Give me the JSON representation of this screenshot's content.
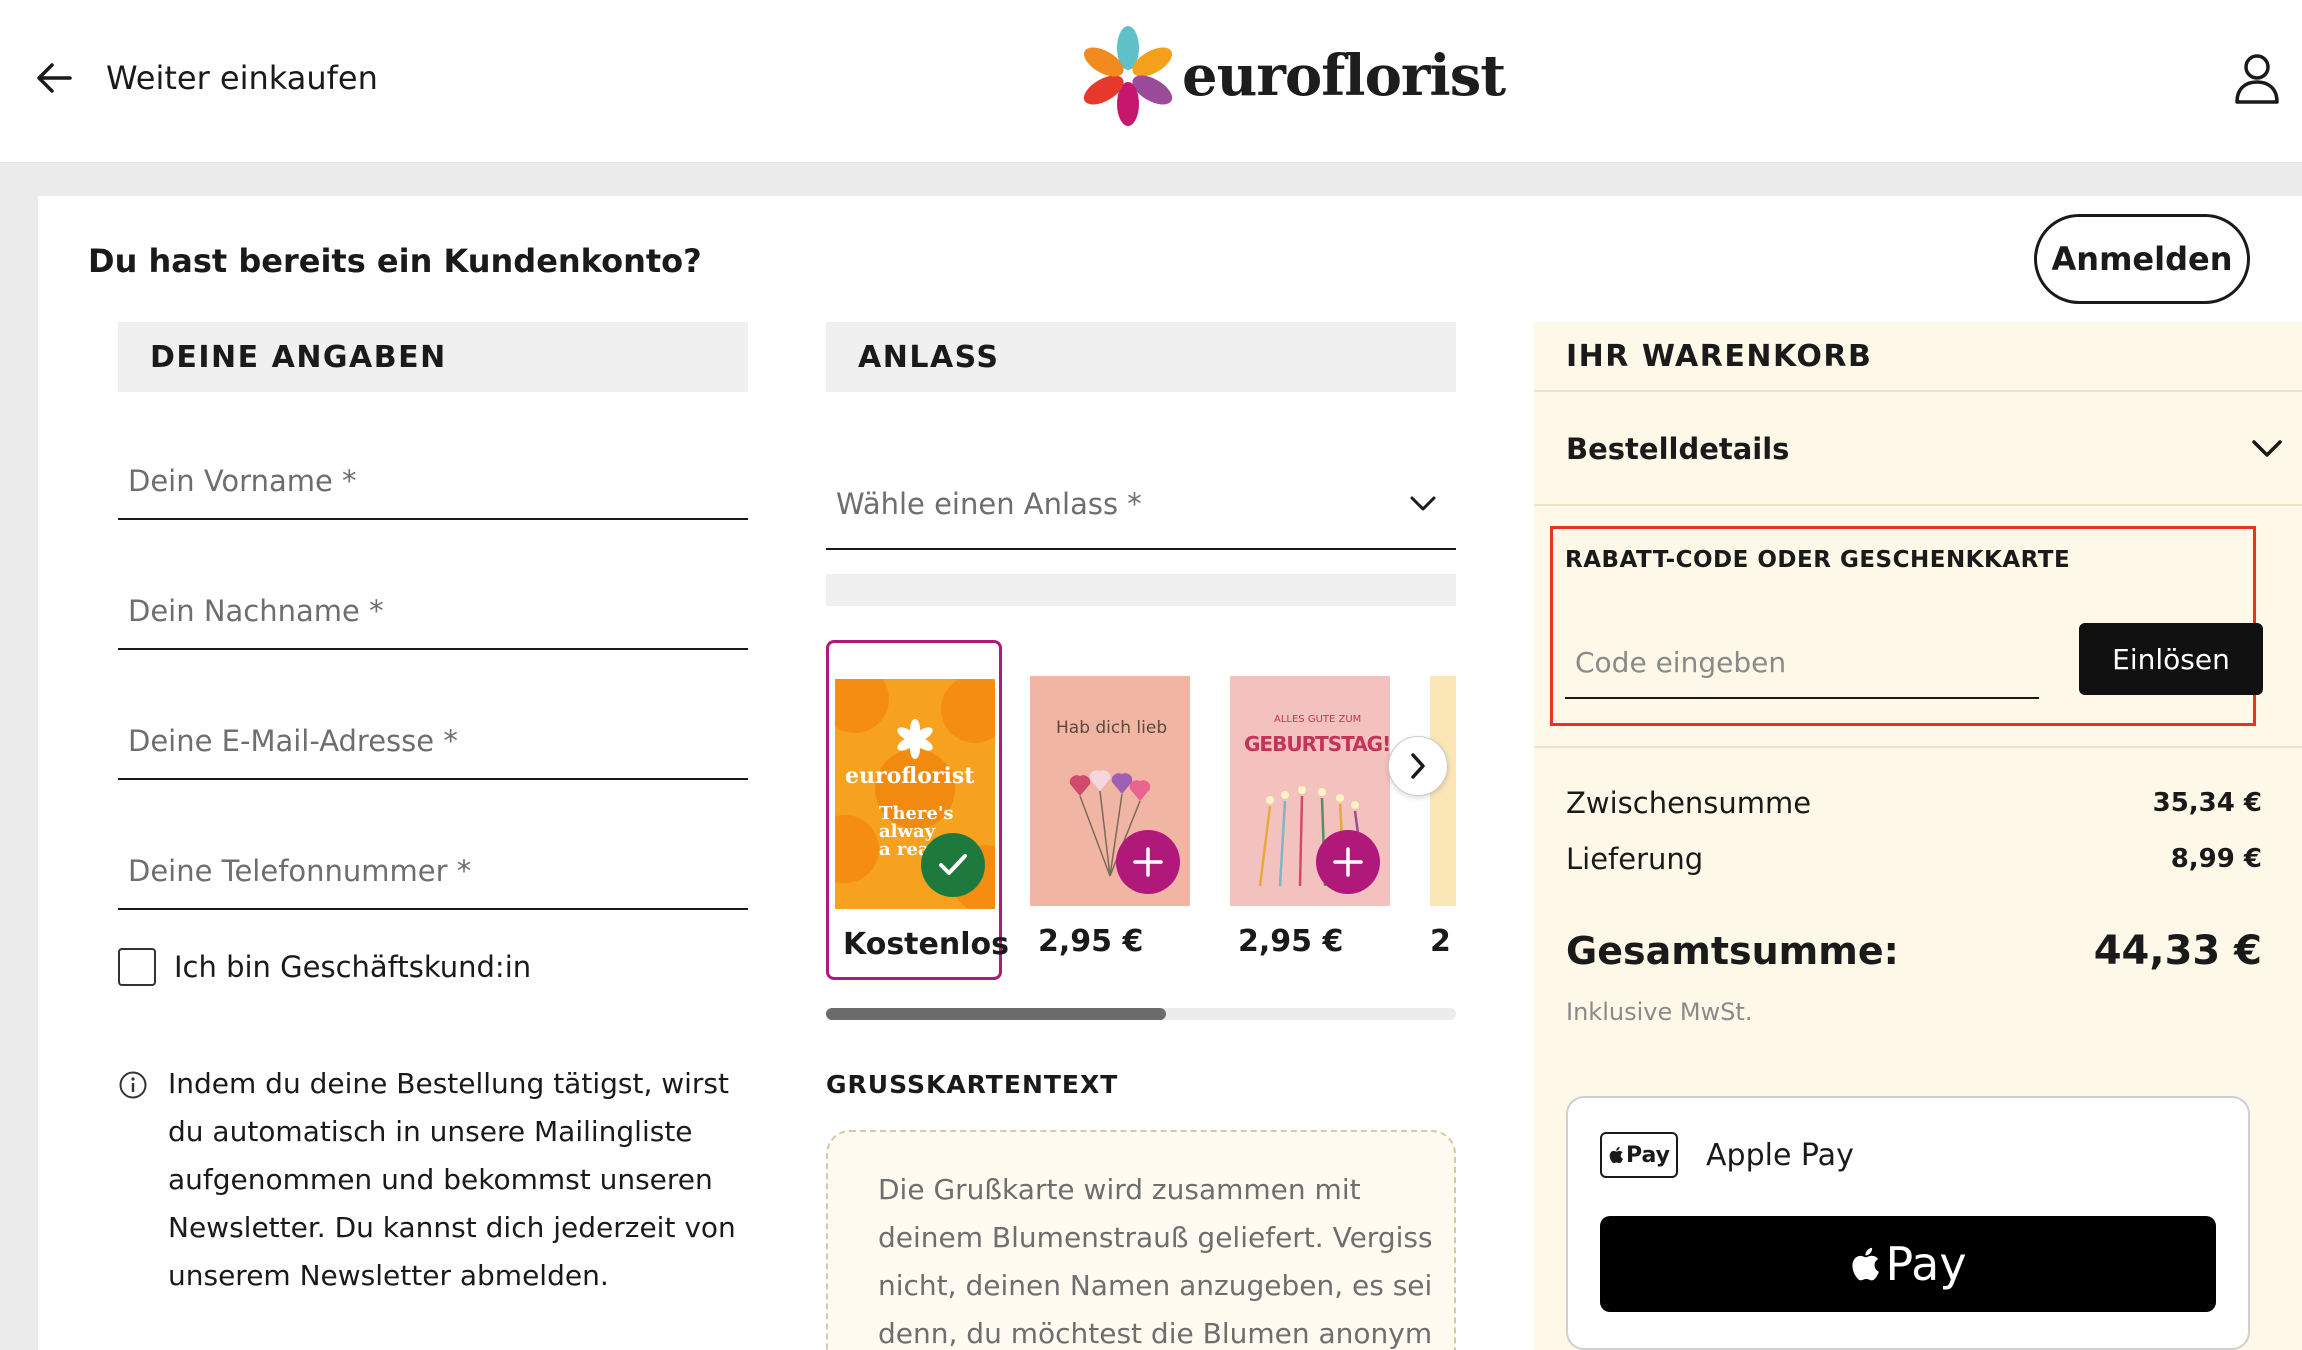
{
  "header": {
    "back_label": "Weiter einkaufen",
    "logo_text": "euroflorist"
  },
  "login": {
    "question": "Du hast bereits ein Kundenkonto?",
    "button": "Anmelden"
  },
  "details": {
    "heading": "DEINE ANGABEN",
    "fields": [
      {
        "placeholder": "Dein Vorname *",
        "value": ""
      },
      {
        "placeholder": "Dein Nachname *",
        "value": ""
      },
      {
        "placeholder": "Deine E-Mail-Adresse *",
        "value": ""
      },
      {
        "placeholder": "Deine Telefonnummer *",
        "value": ""
      }
    ],
    "business_checkbox_label": "Ich bin Geschäftskund:in",
    "business_checked": false,
    "newsletter_info": "Indem du deine Bestellung tätigst, wirst du automatisch in unsere Mailingliste aufgenommen und bekommst unseren Newsletter. Du kannst dich jederzeit von unserem Newsletter abmelden."
  },
  "occasion": {
    "heading": "ANLASS",
    "select_placeholder": "Wähle einen Anlass *",
    "cards": [
      {
        "price": "Kostenlos",
        "selected": true,
        "card_text": [
          "euroflorist",
          "There's",
          "alway",
          "a rea"
        ]
      },
      {
        "price": "2,95 €",
        "selected": false,
        "card_text": [
          "Hab dich lieb"
        ]
      },
      {
        "price": "2,95 €",
        "selected": false,
        "card_text": [
          "ALLES GUTE ZUM",
          "GEBURTSTAG!"
        ]
      },
      {
        "price": "2",
        "selected": false,
        "card_text": []
      }
    ],
    "carousel_scroll_fraction": 0.54,
    "greeting_title": "GRUSSKARTENTEXT",
    "greeting_placeholder": "Die Grußkarte wird zusammen mit deinem Blumenstrauß geliefert. Vergiss nicht, deinen Namen anzugeben, es sei denn, du möchtest die Blumen anonym versenden."
  },
  "cart": {
    "heading": "IHR WARENKORB",
    "details_label": "Bestelldetails",
    "discount_title": "RABATT-CODE ODER GESCHENKKARTE",
    "code_placeholder": "Code eingeben",
    "redeem_button": "Einlösen",
    "subtotal_label": "Zwischensumme",
    "subtotal_value": "35,34 €",
    "delivery_label": "Lieferung",
    "delivery_value": "8,99 €",
    "total_label": "Gesamtsumme:",
    "total_value": "44,33 €",
    "vat_note": "Inklusive MwSt.",
    "payment_method_mark": "Pay",
    "payment_method_label": "Apple Pay",
    "apple_pay_button": "Pay"
  },
  "colors": {
    "accent_magenta": "#b0197a",
    "check_green": "#1e7a3c",
    "highlight_red": "#e63323",
    "cart_background": "#fdf8e8"
  }
}
